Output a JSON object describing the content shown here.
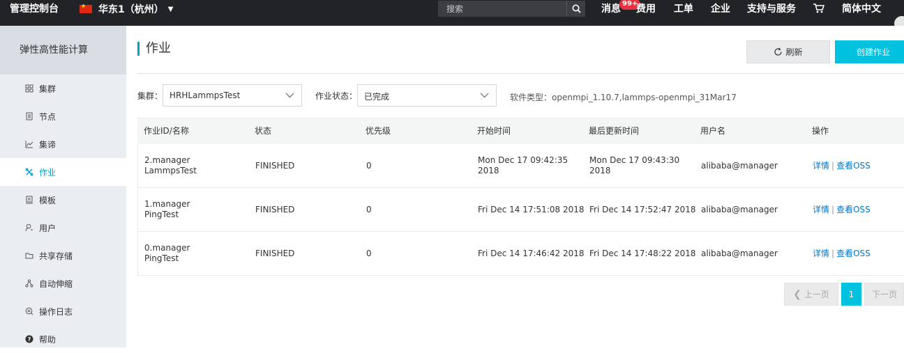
{
  "topbar": {
    "brand": "管理控制台",
    "region": "华东1（杭州）",
    "search_placeholder": "搜索",
    "messages": "消息",
    "messages_badge": "99+",
    "nav": [
      "费用",
      "工单",
      "企业",
      "支持与服务"
    ],
    "language": "简体中文"
  },
  "sidebar": {
    "title": "弹性高性能计算",
    "items": [
      {
        "label": "集群",
        "icon": "grid-icon"
      },
      {
        "label": "节点",
        "icon": "server-icon"
      },
      {
        "label": "集谛",
        "icon": "chart-icon"
      },
      {
        "label": "作业",
        "icon": "tools-icon"
      },
      {
        "label": "模板",
        "icon": "template-icon"
      },
      {
        "label": "用户",
        "icon": "user-icon"
      },
      {
        "label": "共享存储",
        "icon": "folder-icon"
      },
      {
        "label": "自动伸缩",
        "icon": "scale-icon"
      },
      {
        "label": "操作日志",
        "icon": "log-icon"
      },
      {
        "label": "帮助",
        "icon": "help-icon"
      }
    ],
    "active_index": 3
  },
  "page": {
    "title": "作业",
    "refresh_label": "刷新",
    "create_label": "创建作业"
  },
  "filters": {
    "cluster_label": "集群：",
    "cluster_value": "HRHLammpsTest",
    "status_label": "作业状态：",
    "status_value": "已完成",
    "software_info": "软件类型：openmpi_1.10.7,lammps-openmpi_31Mar17"
  },
  "table": {
    "headers": [
      "作业ID/名称",
      "状态",
      "优先级",
      "开始时间",
      "最后更新时间",
      "用户名",
      "操作"
    ],
    "rows": [
      {
        "id": "2.manager",
        "name": "LammpsTest",
        "status": "FINISHED",
        "priority": "0",
        "start_1": "Mon Dec 17 09:42:35",
        "start_2": "2018",
        "updated_1": "Mon Dec 17 09:43:30",
        "updated_2": "2018",
        "user": "alibaba@manager",
        "action_detail": "详情",
        "action_sep": "|",
        "action_oss": "查看OSS"
      },
      {
        "id": "1.manager",
        "name": "PingTest",
        "status": "FINISHED",
        "priority": "0",
        "start": "Fri Dec 14 17:51:08 2018",
        "updated": "Fri Dec 14 17:52:47 2018",
        "user": "alibaba@manager",
        "action_detail": "详情",
        "action_sep": "|",
        "action_oss": "查看OSS"
      },
      {
        "id": "0.manager",
        "name": "PingTest",
        "status": "FINISHED",
        "priority": "0",
        "start": "Fri Dec 14 17:46:42 2018",
        "updated": "Fri Dec 14 17:48:22 2018",
        "user": "alibaba@manager",
        "action_detail": "详情",
        "action_sep": "|",
        "action_oss": "查看OSS"
      }
    ]
  },
  "pagination": {
    "prev": "上一页",
    "current": "1",
    "next": "下一页"
  }
}
